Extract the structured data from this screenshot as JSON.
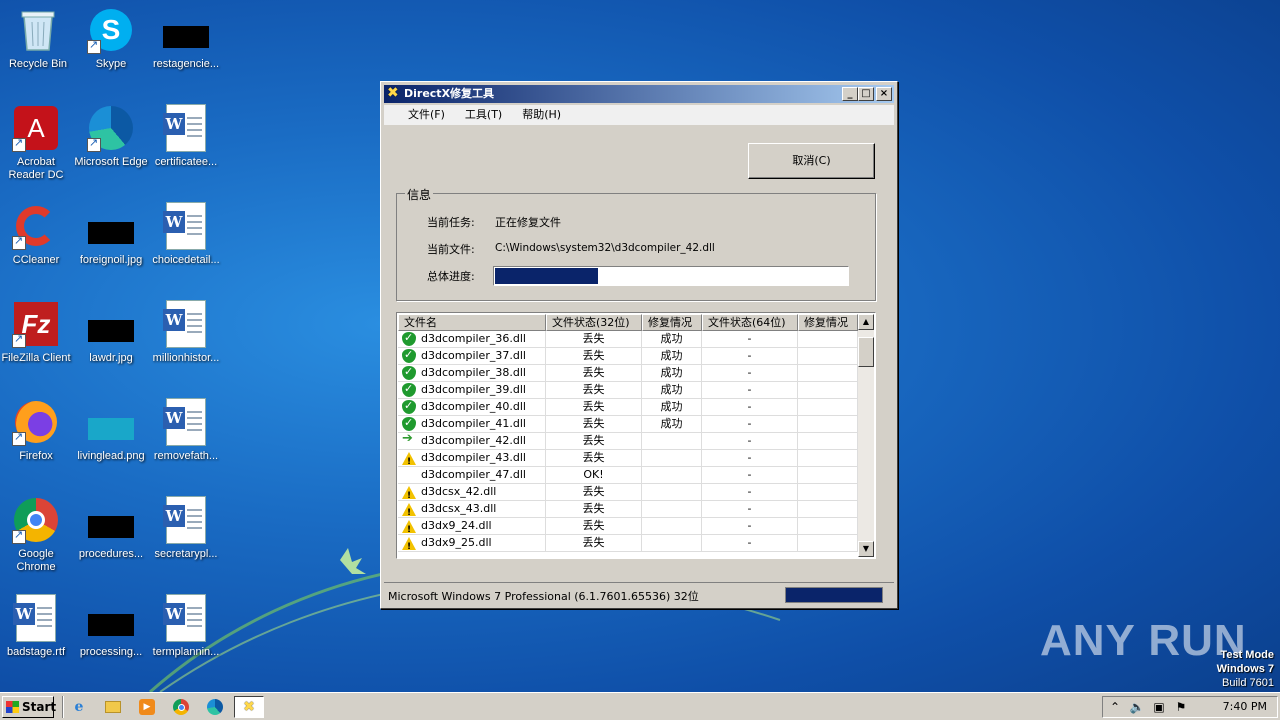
{
  "desktop": {
    "icons": [
      {
        "label": "Recycle Bin"
      },
      {
        "label": "Skype"
      },
      {
        "label": "restagencie..."
      },
      {
        "label": "Acrobat Reader DC"
      },
      {
        "label": "Microsoft Edge"
      },
      {
        "label": "certificatee..."
      },
      {
        "label": "CCleaner"
      },
      {
        "label": "foreignoil.jpg"
      },
      {
        "label": "choicedetail..."
      },
      {
        "label": "FileZilla Client"
      },
      {
        "label": "lawdr.jpg"
      },
      {
        "label": "millionhistor..."
      },
      {
        "label": "Firefox"
      },
      {
        "label": "livinglead.png"
      },
      {
        "label": "removefath..."
      },
      {
        "label": "Google Chrome"
      },
      {
        "label": "procedures..."
      },
      {
        "label": "secretarypl..."
      },
      {
        "label": "badstage.rtf"
      },
      {
        "label": "processing..."
      },
      {
        "label": "termplannin..."
      }
    ]
  },
  "dialog": {
    "title": "DirectX修复工具",
    "menu": [
      "文件(F)",
      "工具(T)",
      "帮助(H)"
    ],
    "cancel_label": "取消(C)",
    "info_legend": "信息",
    "task_label": "当前任务:",
    "task_value": "正在修复文件",
    "file_label": "当前文件:",
    "file_value": "C:\\Windows\\system32\\d3dcompiler_42.dll",
    "progress_label": "总体进度:",
    "progress_fraction": 0.29,
    "columns": [
      "文件名",
      "文件状态(32位)",
      "修复情况",
      "文件状态(64位)",
      "修复情况"
    ],
    "rows": [
      {
        "icon": "green-shield-check-icon",
        "name": "d3dcompiler_36.dll",
        "s32": "丢失",
        "r32": "成功",
        "s64": "-",
        "r64": ""
      },
      {
        "icon": "green-shield-check-icon",
        "name": "d3dcompiler_37.dll",
        "s32": "丢失",
        "r32": "成功",
        "s64": "-",
        "r64": ""
      },
      {
        "icon": "green-shield-check-icon",
        "name": "d3dcompiler_38.dll",
        "s32": "丢失",
        "r32": "成功",
        "s64": "-",
        "r64": ""
      },
      {
        "icon": "green-shield-check-icon",
        "name": "d3dcompiler_39.dll",
        "s32": "丢失",
        "r32": "成功",
        "s64": "-",
        "r64": ""
      },
      {
        "icon": "green-shield-check-icon",
        "name": "d3dcompiler_40.dll",
        "s32": "丢失",
        "r32": "成功",
        "s64": "-",
        "r64": ""
      },
      {
        "icon": "green-shield-check-icon",
        "name": "d3dcompiler_41.dll",
        "s32": "丢失",
        "r32": "成功",
        "s64": "-",
        "r64": ""
      },
      {
        "icon": "green-arrow-icon",
        "name": "d3dcompiler_42.dll",
        "s32": "丢失",
        "r32": "",
        "s64": "-",
        "r64": ""
      },
      {
        "icon": "warning-icon",
        "name": "d3dcompiler_43.dll",
        "s32": "丢失",
        "r32": "",
        "s64": "-",
        "r64": ""
      },
      {
        "icon": "none",
        "name": "d3dcompiler_47.dll",
        "s32": "OK!",
        "r32": "",
        "s64": "-",
        "r64": ""
      },
      {
        "icon": "warning-icon",
        "name": "d3dcsx_42.dll",
        "s32": "丢失",
        "r32": "",
        "s64": "-",
        "r64": ""
      },
      {
        "icon": "warning-icon",
        "name": "d3dcsx_43.dll",
        "s32": "丢失",
        "r32": "",
        "s64": "-",
        "r64": ""
      },
      {
        "icon": "warning-icon",
        "name": "d3dx9_24.dll",
        "s32": "丢失",
        "r32": "",
        "s64": "-",
        "r64": ""
      },
      {
        "icon": "warning-icon",
        "name": "d3dx9_25.dll",
        "s32": "丢失",
        "r32": "",
        "s64": "-",
        "r64": ""
      }
    ],
    "status_text": "Microsoft Windows 7 Professional (6.1.7601.65536) 32位",
    "status_progress_fraction": 1.0
  },
  "taskbar": {
    "start_label": "Start",
    "clock": "7:40 PM",
    "pinned": [
      "internet-explorer-icon",
      "file-explorer-icon",
      "media-player-icon",
      "chrome-icon",
      "edge-icon",
      "directx-repair-icon"
    ]
  },
  "watermark": {
    "line1": "Test Mode",
    "line2": "Windows 7",
    "line3": "Build 7601",
    "brand": "ANY RUN"
  },
  "colors": {
    "titlebar_start": "#0a246a",
    "progress_fill": "#0a246a",
    "ok_green": "#1f9a2e",
    "warn_yellow": "#f2c200"
  }
}
